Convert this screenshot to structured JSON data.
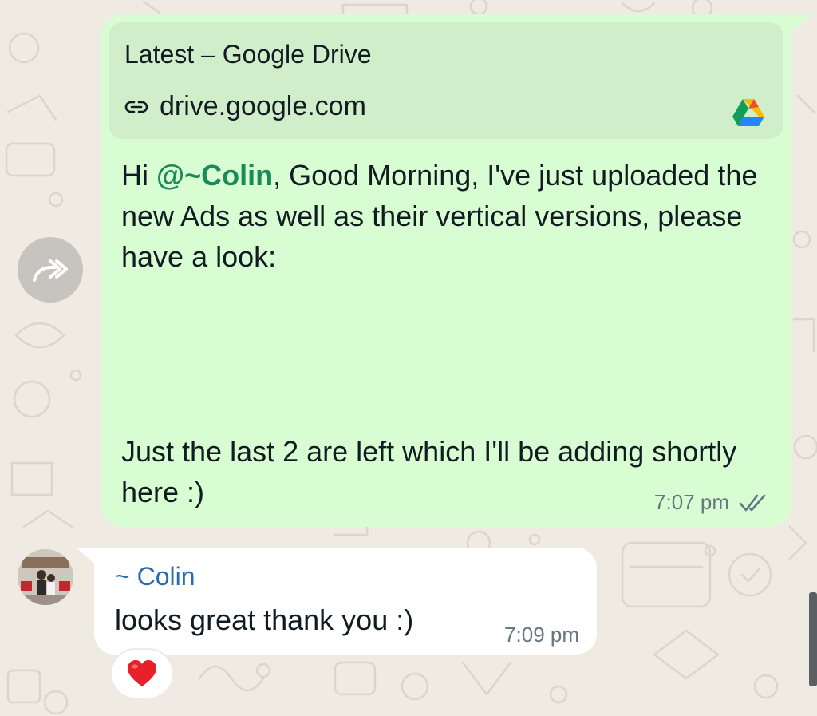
{
  "outgoing": {
    "link_preview": {
      "title": "Latest – Google Drive",
      "url": "drive.google.com",
      "site_icon": "google-drive-icon"
    },
    "text_greeting": "Hi ",
    "mention": "@~Colin",
    "text_after_mention": ", Good Morning, I've just uploaded the new Ads as well as their vertical versions, please have a look:",
    "text_followup": "Just the last 2 are left which I'll be adding shortly here :)",
    "time": "7:07 pm",
    "status_icon": "double-check-read-icon"
  },
  "incoming": {
    "sender": "~ Colin",
    "text": "looks great thank you :)",
    "time": "7:09 pm",
    "reaction": "❤️"
  },
  "forward_icon": "forward-icon",
  "colors": {
    "background": "#efeae2",
    "outgoing_bubble": "#d9fdd3",
    "link_preview": "#cfeec9",
    "incoming_bubble": "#ffffff",
    "mention": "#1b8a5a",
    "sender": "#2b6cb0",
    "meta": "#667781"
  }
}
